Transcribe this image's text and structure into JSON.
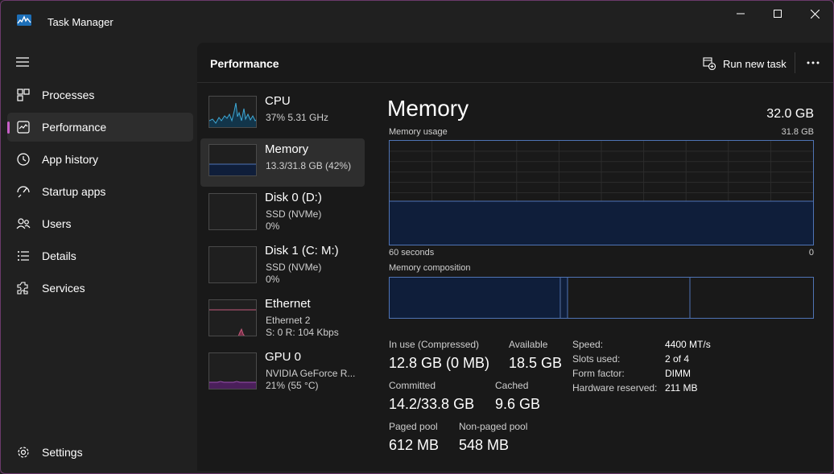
{
  "window": {
    "title": "Task Manager"
  },
  "sidebar": {
    "items": [
      {
        "label": "Processes",
        "icon": "processes-icon"
      },
      {
        "label": "Performance",
        "icon": "performance-icon",
        "active": true
      },
      {
        "label": "App history",
        "icon": "history-icon"
      },
      {
        "label": "Startup apps",
        "icon": "startup-icon"
      },
      {
        "label": "Users",
        "icon": "users-icon"
      },
      {
        "label": "Details",
        "icon": "details-icon"
      },
      {
        "label": "Services",
        "icon": "services-icon"
      }
    ],
    "settings_label": "Settings"
  },
  "header": {
    "title": "Performance",
    "run_task_label": "Run new task"
  },
  "resources": [
    {
      "name": "CPU",
      "line1": "37%  5.31 GHz",
      "line2": ""
    },
    {
      "name": "Memory",
      "line1": "13.3/31.8 GB (42%)",
      "line2": "",
      "active": true
    },
    {
      "name": "Disk 0 (D:)",
      "line1": "SSD (NVMe)",
      "line2": "0%"
    },
    {
      "name": "Disk 1 (C: M:)",
      "line1": "SSD (NVMe)",
      "line2": "0%"
    },
    {
      "name": "Ethernet",
      "line1": "Ethernet 2",
      "line2": "S: 0  R: 104 Kbps"
    },
    {
      "name": "GPU 0",
      "line1": "NVIDIA GeForce R...",
      "line2": "21%  (55 °C)"
    }
  ],
  "detail": {
    "title": "Memory",
    "total": "32.0 GB",
    "usage_label": "Memory usage",
    "usage_max": "31.8 GB",
    "time_label": "60 seconds",
    "time_end": "0",
    "usage_fraction": 0.42,
    "composition_label": "Memory composition",
    "composition_fractions": {
      "in_use": 0.403,
      "modified": 0.017,
      "standby": 0.29,
      "free": 0.29
    },
    "stats": {
      "in_use_label": "In use (Compressed)",
      "in_use_value": "12.8 GB (0 MB)",
      "available_label": "Available",
      "available_value": "18.5 GB",
      "committed_label": "Committed",
      "committed_value": "14.2/33.8 GB",
      "cached_label": "Cached",
      "cached_value": "9.6 GB",
      "paged_label": "Paged pool",
      "paged_value": "612 MB",
      "nonpaged_label": "Non-paged pool",
      "nonpaged_value": "548 MB"
    },
    "specs": {
      "speed_label": "Speed:",
      "speed_value": "4400 MT/s",
      "slots_label": "Slots used:",
      "slots_value": "2 of 4",
      "form_label": "Form factor:",
      "form_value": "DIMM",
      "reserved_label": "Hardware reserved:",
      "reserved_value": "211 MB"
    }
  },
  "colors": {
    "accent": "#c75fc7",
    "memory_line": "#4f74b5",
    "memory_fill": "#0f1e3a",
    "cpu_line": "#3fa9d6",
    "ethernet_line": "#c65b7c",
    "gpu_line": "#9c4fb3"
  }
}
